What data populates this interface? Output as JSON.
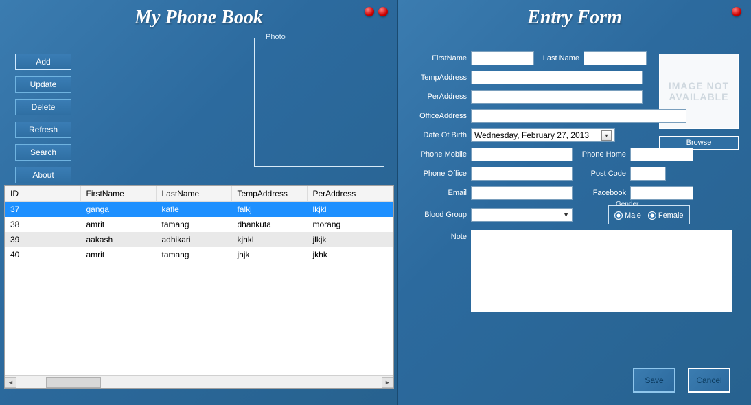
{
  "left": {
    "title": "My Phone Book",
    "buttons": {
      "add": "Add",
      "update": "Update",
      "delete": "Delete",
      "refresh": "Refresh",
      "search": "Search",
      "about": "About"
    },
    "photo_legend": "Photo",
    "grid": {
      "headers": [
        "ID",
        "FirstName",
        "LastName",
        "TempAddress",
        "PerAddress"
      ],
      "rows": [
        {
          "id": "37",
          "fn": "ganga",
          "ln": "kafle",
          "ta": "falkj",
          "pa": "lkjkl",
          "selected": true
        },
        {
          "id": "38",
          "fn": "amrit",
          "ln": "tamang",
          "ta": "dhankuta",
          "pa": "morang"
        },
        {
          "id": "39",
          "fn": "aakash",
          "ln": "adhikari",
          "ta": "kjhkl",
          "pa": "jlkjk",
          "alt": true
        },
        {
          "id": "40",
          "fn": "amrit",
          "ln": "tamang",
          "ta": "jhjk",
          "pa": "jkhk"
        }
      ]
    }
  },
  "right": {
    "title": "Entry Form",
    "labels": {
      "firstname": "FirstName",
      "lastname": "Last Name",
      "tempaddress": "TempAddress",
      "peraddress": "PerAddress",
      "officeaddress": "OfficeAddress",
      "dob": "Date Of Birth",
      "phonemobile": "Phone Mobile",
      "phonehome": "Phone Home",
      "phoneoffice": "Phone Office",
      "postcode": "Post Code",
      "email": "Email",
      "facebook": "Facebook",
      "bloodgroup": "Blood Group",
      "gender": "Gender",
      "male": "Male",
      "female": "Female",
      "note": "Note",
      "image_ph": "IMAGE NOT AVAILABLE",
      "browse": "Browse",
      "save": "Save",
      "cancel": "Cancel"
    },
    "dob_value": "Wednesday,   February   27, 2013"
  }
}
